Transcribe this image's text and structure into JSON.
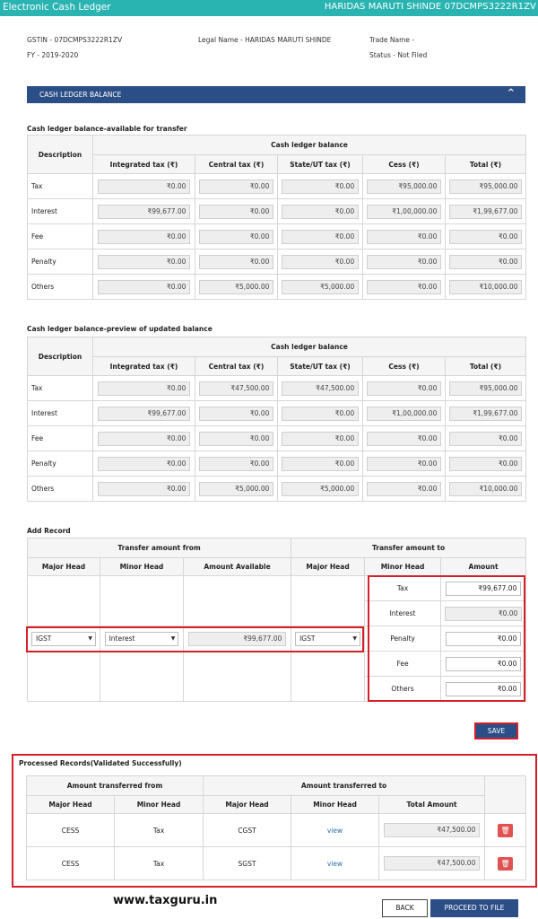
{
  "header": {
    "title": "Electronic Cash Ledger",
    "user": "HARIDAS MARUTI SHINDE 07DCMPS3222R1ZV"
  },
  "info": {
    "gstin": "GSTIN - 07DCMPS3222R1ZV",
    "fy": "FY - 2019-2020",
    "legal_name": "Legal Name - HARIDAS MARUTI SHINDE",
    "trade_name": "Trade Name -",
    "status": "Status - Not Filed"
  },
  "ledger_bar": {
    "label": "CASH LEDGER BALANCE",
    "chevron": "^"
  },
  "columns": {
    "description": "Description",
    "group": "Cash ledger balance",
    "heads": [
      "Integrated tax (₹)",
      "Central tax (₹)",
      "State/UT tax (₹)",
      "Cess (₹)",
      "Total (₹)"
    ]
  },
  "available": {
    "title": "Cash ledger balance-available for transfer",
    "rows": [
      {
        "label": "Tax",
        "values": [
          "₹0.00",
          "₹0.00",
          "₹0.00",
          "₹95,000.00",
          "₹95,000.00"
        ]
      },
      {
        "label": "Interest",
        "values": [
          "₹99,677.00",
          "₹0.00",
          "₹0.00",
          "₹1,00,000.00",
          "₹1,99,677.00"
        ]
      },
      {
        "label": "Fee",
        "values": [
          "₹0.00",
          "₹0.00",
          "₹0.00",
          "₹0.00",
          "₹0.00"
        ]
      },
      {
        "label": "Penalty",
        "values": [
          "₹0.00",
          "₹0.00",
          "₹0.00",
          "₹0.00",
          "₹0.00"
        ]
      },
      {
        "label": "Others",
        "values": [
          "₹0.00",
          "₹5,000.00",
          "₹5,000.00",
          "₹0.00",
          "₹10,000.00"
        ]
      }
    ]
  },
  "preview": {
    "title": "Cash ledger balance-preview of updated balance",
    "rows": [
      {
        "label": "Tax",
        "values": [
          "₹0.00",
          "₹47,500.00",
          "₹47,500.00",
          "₹0.00",
          "₹95,000.00"
        ]
      },
      {
        "label": "Interest",
        "values": [
          "₹99,677.00",
          "₹0.00",
          "₹0.00",
          "₹1,00,000.00",
          "₹1,99,677.00"
        ]
      },
      {
        "label": "Fee",
        "values": [
          "₹0.00",
          "₹0.00",
          "₹0.00",
          "₹0.00",
          "₹0.00"
        ]
      },
      {
        "label": "Penalty",
        "values": [
          "₹0.00",
          "₹0.00",
          "₹0.00",
          "₹0.00",
          "₹0.00"
        ]
      },
      {
        "label": "Others",
        "values": [
          "₹0.00",
          "₹5,000.00",
          "₹5,000.00",
          "₹0.00",
          "₹10,000.00"
        ]
      }
    ]
  },
  "add_record": {
    "title": "Add Record",
    "from_group": "Transfer amount from",
    "to_group": "Transfer amount to",
    "h_major": "Major Head",
    "h_minor": "Minor Head",
    "h_avail": "Amount Available",
    "h_to_major": "Major Head",
    "h_to_minor": "Minor Head",
    "h_amount": "Amount",
    "from_major": "IGST",
    "from_minor": "Interest",
    "available_amount": "₹99,677.00",
    "to_major": "IGST",
    "caret": "▼",
    "to_rows": [
      {
        "label": "Tax",
        "value": "₹99,677.00"
      },
      {
        "label": "Interest",
        "value": "₹0.00"
      },
      {
        "label": "Penalty",
        "value": "₹0.00"
      },
      {
        "label": "Fee",
        "value": "₹0.00"
      },
      {
        "label": "Others",
        "value": "₹0.00"
      }
    ],
    "save_label": "SAVE"
  },
  "processed": {
    "title": "Processed Records(Validated Successfully)",
    "from_group": "Amount transferred from",
    "to_group": "Amount transferred to",
    "heads": [
      "Major Head",
      "Minor Head",
      "Major Head",
      "Minor Head",
      "Total Amount"
    ],
    "rows": [
      {
        "from_major": "CESS",
        "from_minor": "Tax",
        "to_major": "CGST",
        "to_minor": "view",
        "amount": "₹47,500.00"
      },
      {
        "from_major": "CESS",
        "from_minor": "Tax",
        "to_major": "SGST",
        "to_minor": "view",
        "amount": "₹47,500.00"
      }
    ],
    "delete_glyph": "🗑"
  },
  "footer": {
    "watermark": "www.taxguru.in",
    "back_label": "BACK",
    "proceed_label": "PROCEED TO FILE"
  }
}
